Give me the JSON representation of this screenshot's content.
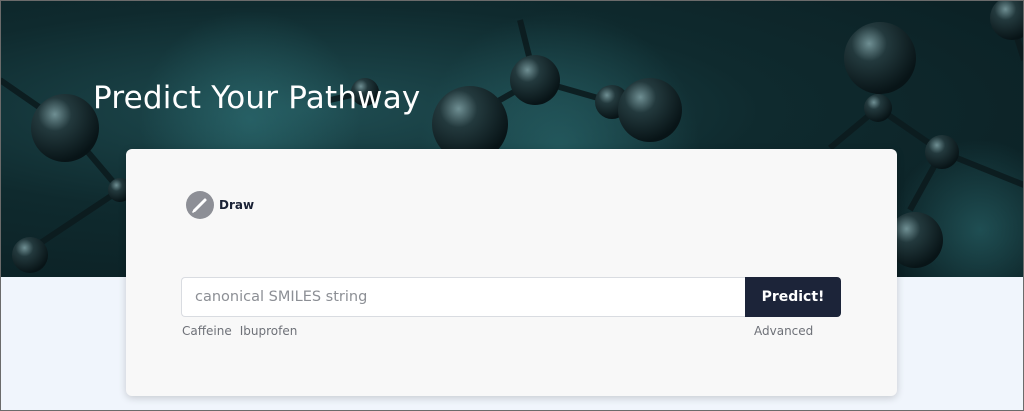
{
  "hero": {
    "title": "Predict Your Pathway"
  },
  "card": {
    "draw_label": "Draw",
    "smiles_input": {
      "placeholder": "canonical SMILES string",
      "value": ""
    },
    "predict_label": "Predict!",
    "examples": [
      "Caffeine",
      "Ibuprofen"
    ],
    "advanced_label": "Advanced"
  },
  "icons": {
    "draw": "pencil-icon"
  },
  "colors": {
    "hero_dark": "#0f2a2e",
    "card_background": "#f8f8f8",
    "predict_button": "#1c2439",
    "page_background": "#f0f5fc"
  }
}
